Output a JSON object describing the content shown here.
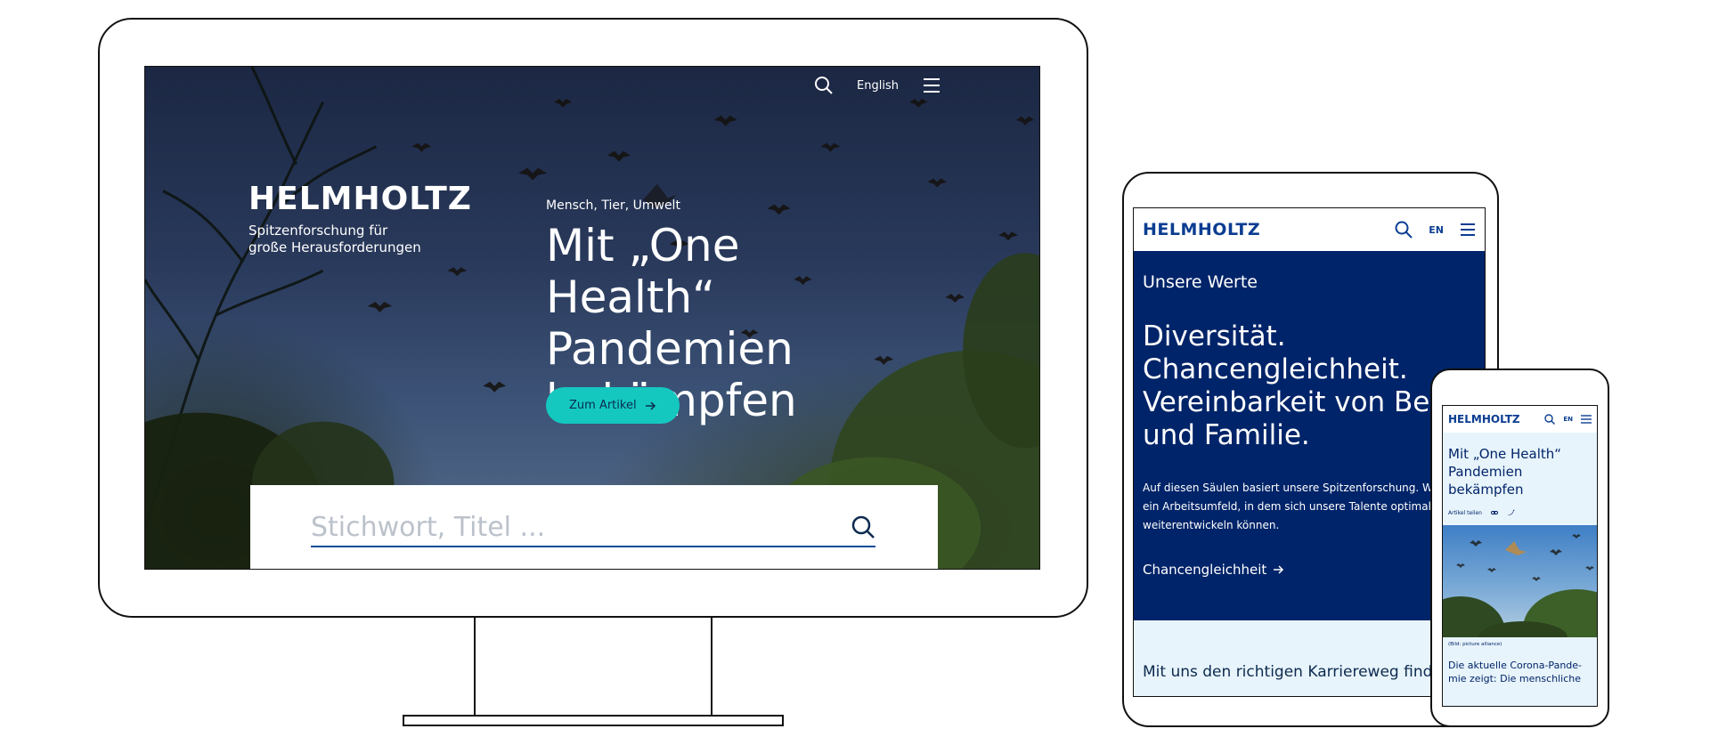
{
  "desktop": {
    "nav": {
      "lang_label": "English"
    },
    "brand": {
      "logo": "HELMHOLTZ",
      "tagline_line1": "Spitzenforschung für",
      "tagline_line2": "große Herausforderungen"
    },
    "hero": {
      "kicker": "Mensch, Tier, Umwelt",
      "title_line1": "Mit „One Health“",
      "title_line2": "Pandemien",
      "title_line3": "bekämpfen",
      "cta_label": "Zum Artikel"
    },
    "search": {
      "placeholder": "Stichwort, Titel ..."
    }
  },
  "tablet": {
    "logo": "HELMHOLTZ",
    "lang_label": "EN",
    "section_kicker": "Unsere Werte",
    "title_line1": "Diversität.",
    "title_line2": "Chancengleichheit.",
    "title_line3": "Vereinbarkeit von Beruf",
    "title_line4": "und Familie.",
    "body_line1": "Auf diesen Säulen basiert unsere Spitzenforschung. Wir",
    "body_line2": "ein Arbeitsumfeld, in dem sich unsere Talente optimal",
    "body_line3": "weiterentwickeln können.",
    "link_label": "Chancengleichheit",
    "footer_text": "Mit uns den richtigen Karriereweg finde"
  },
  "phone": {
    "logo": "HELMHOLTZ",
    "lang_label": "EN",
    "title_line1": "Mit „One Health“",
    "title_line2": "Pandemien",
    "title_line3": "bekämpfen",
    "share_label": "Artikel teilen",
    "image_caption": "(Bild: picture alliance)",
    "teaser_line1": "Die aktuelle Corona-Pande-",
    "teaser_line2": "mie zeigt: Die menschliche"
  },
  "colors": {
    "brand_blue": "#002469",
    "logo_blue": "#0b3d91",
    "cta_teal": "#14c8c0",
    "light_bg": "#e8f4fb"
  },
  "icons": [
    "search-icon",
    "menu-icon",
    "arrow-right-icon",
    "link-icon",
    "twitter-icon"
  ]
}
